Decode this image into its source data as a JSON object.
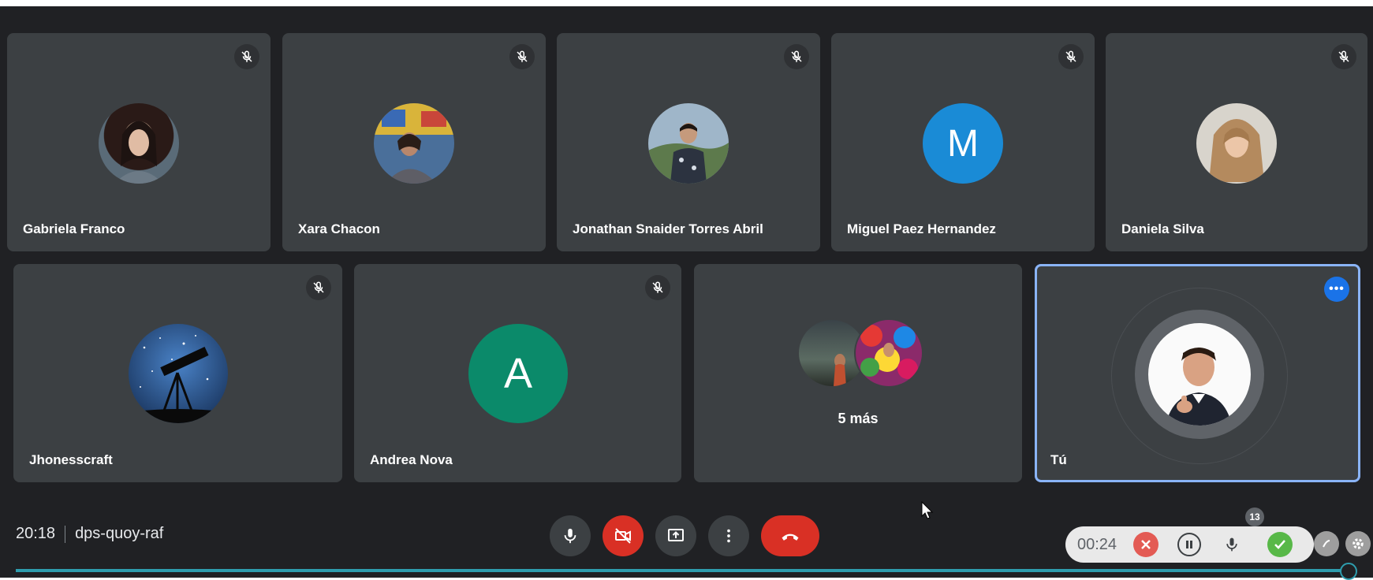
{
  "participants": [
    {
      "name": "Gabriela Franco",
      "muted": true,
      "avatar": "photo-woman-dark-hair"
    },
    {
      "name": "Xara Chacon",
      "muted": true,
      "avatar": "photo-woman-classroom"
    },
    {
      "name": "Jonathan Snaider Torres Abril",
      "muted": true,
      "avatar": "photo-man-outdoors"
    },
    {
      "name": "Miguel Paez Hernandez",
      "muted": true,
      "avatar_letter": "M",
      "avatar_color": "#1a8bd6"
    },
    {
      "name": "Daniela Silva",
      "muted": true,
      "avatar": "photo-woman-blonde"
    },
    {
      "name": "Jhonesscraft",
      "muted": true,
      "avatar": "photo-telescope-stars"
    },
    {
      "name": "Andrea Nova",
      "muted": true,
      "avatar_letter": "A",
      "avatar_color": "#0b8043"
    },
    {
      "name": "5 más",
      "muted": false,
      "avatar": "group-photos"
    },
    {
      "name": "Tú",
      "muted": false,
      "avatar": "photo-man-thumbs-up",
      "highlighted": true
    }
  ],
  "meeting": {
    "time": "20:18",
    "code": "dps-quoy-raf"
  },
  "controls": [
    {
      "name": "microphone-button",
      "icon": "mic-icon",
      "color": "#3c4043"
    },
    {
      "name": "camera-off-button",
      "icon": "video-off-icon",
      "color": "#d93025"
    },
    {
      "name": "present-button",
      "icon": "present-screen-icon",
      "color": "#3c4043"
    },
    {
      "name": "more-options-button",
      "icon": "more-vert-icon",
      "color": "#3c4043"
    },
    {
      "name": "leave-call-button",
      "icon": "hang-up-icon",
      "color": "#d93025"
    }
  ],
  "recorder": {
    "time": "00:24",
    "badge_count": "13"
  },
  "colors": {
    "background": "#202124",
    "tile": "#3c4043",
    "accent": "#8ab4f8",
    "progress": "#2e9dae"
  }
}
